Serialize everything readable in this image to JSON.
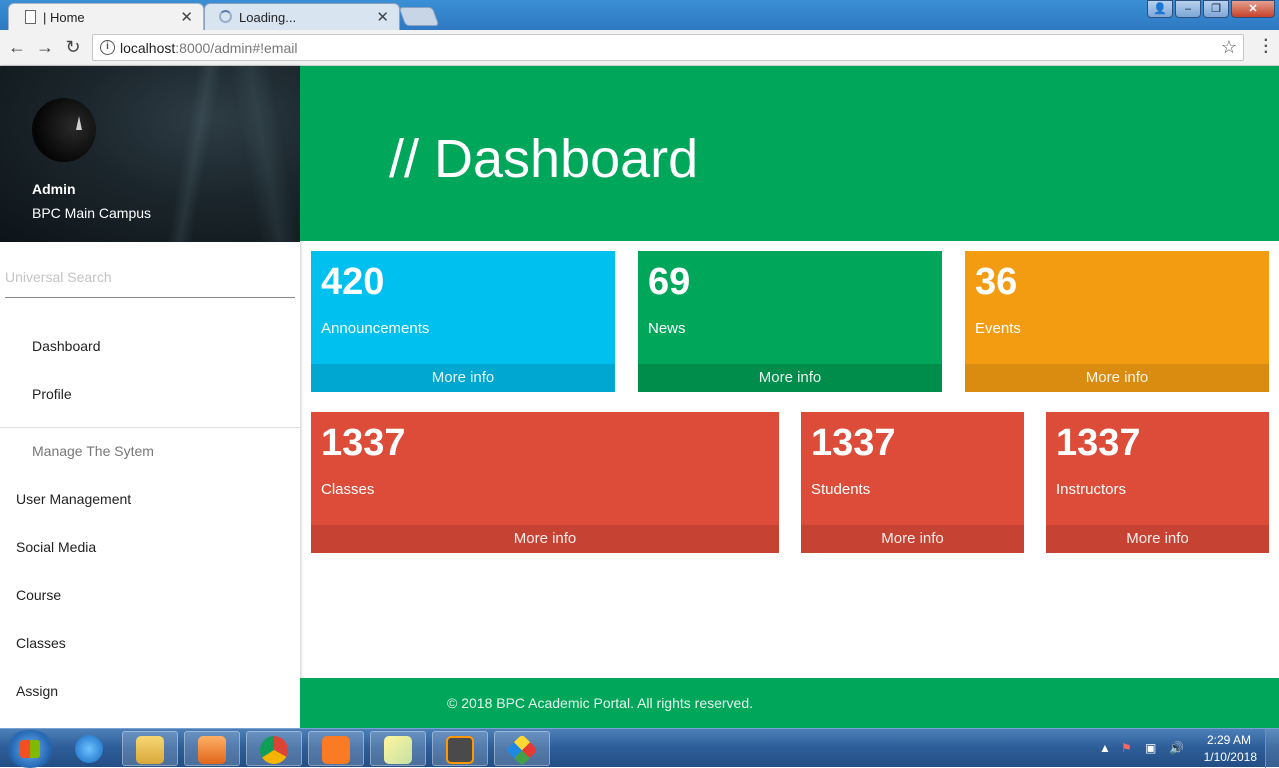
{
  "browser": {
    "tabs": [
      {
        "title": "| Home",
        "close": "✕"
      },
      {
        "title": "Loading...",
        "close": "✕"
      }
    ],
    "url_host": "localhost",
    "url_path": ":8000/admin#!email",
    "icons": {
      "back": "arrow-left-icon",
      "forward": "arrow-right-icon",
      "reload": "reload-icon",
      "info": "info-icon",
      "bookmark": "star-icon",
      "menu": "more-vert-icon"
    }
  },
  "sidebar": {
    "profile": {
      "name": "Admin",
      "campus": "BPC Main Campus"
    },
    "search_placeholder": "Universal Search",
    "items": [
      {
        "label": "Dashboard"
      },
      {
        "label": "Profile"
      }
    ],
    "section_label": "Manage The Sytem",
    "manage_items": [
      {
        "label": "User Management"
      },
      {
        "label": "Social Media"
      },
      {
        "label": "Course"
      },
      {
        "label": "Classes"
      },
      {
        "label": "Assign"
      }
    ]
  },
  "header": {
    "title": "// Dashboard"
  },
  "stats": [
    {
      "value": "420",
      "label": "Announcements",
      "more": "More info",
      "color": "#00c0ef",
      "footer_color": "#00a7d0"
    },
    {
      "value": "69",
      "label": "News",
      "more": "More info",
      "color": "#00a65a",
      "footer_color": "#008d4c"
    },
    {
      "value": "36",
      "label": "Events",
      "more": "More info",
      "color": "#f39c12",
      "footer_color": "#da8c10"
    },
    {
      "value": "1337",
      "label": "Classes",
      "more": "More info",
      "color": "#dd4b39",
      "footer_color": "#c64333"
    },
    {
      "value": "1337",
      "label": "Students",
      "more": "More info",
      "color": "#dd4b39",
      "footer_color": "#c64333"
    },
    {
      "value": "1337",
      "label": "Instructors",
      "more": "More info",
      "color": "#dd4b39",
      "footer_color": "#c64333"
    }
  ],
  "footer": {
    "text": "© 2018 BPC Academic Portal. All rights reserved."
  },
  "taskbar": {
    "apps": [
      "internet-explorer-icon",
      "file-explorer-icon",
      "media-player-icon",
      "chrome-icon",
      "xampp-icon",
      "sticky-notes-icon",
      "sublime-text-icon",
      "app-icon"
    ],
    "clock_time": "2:29 AM",
    "clock_date": "1/10/2018"
  }
}
